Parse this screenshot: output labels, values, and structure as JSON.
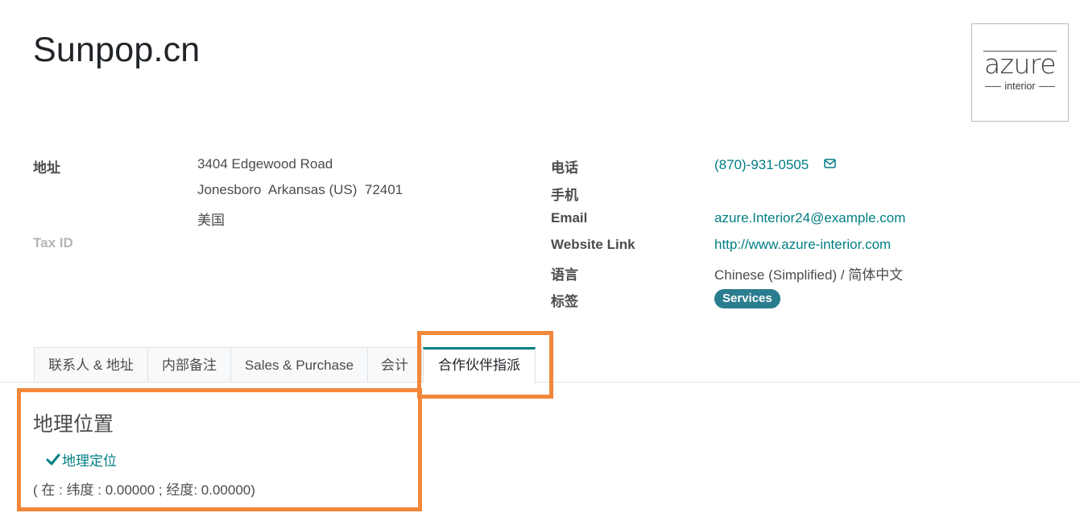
{
  "record": {
    "name": "Sunpop.cn"
  },
  "avatar": {
    "logo_text": "azure",
    "logo_subtext": "interior"
  },
  "address": {
    "label": "地址",
    "street": "3404 Edgewood Road",
    "city_line": "Jonesboro  Arkansas (US)  72401",
    "country": "美国"
  },
  "tax_id": {
    "label": "Tax ID"
  },
  "contact": {
    "phone_label": "电话",
    "phone": "(870)-931-0505",
    "mobile_label": "手机",
    "email_label": "Email",
    "email": "azure.Interior24@example.com",
    "website_label": "Website Link",
    "website": "http://www.azure-interior.com",
    "language_label": "语言",
    "language": "Chinese (Simplified) / 简体中文",
    "tags_label": "标签",
    "tag": "Services"
  },
  "tabs": [
    {
      "label": "联系人 & 地址"
    },
    {
      "label": "内部备注"
    },
    {
      "label": "Sales & Purchase"
    },
    {
      "label": "会计"
    },
    {
      "label": "合作伙伴指派",
      "active": true
    }
  ],
  "geo": {
    "title": "地理位置",
    "button_label": "地理定位",
    "coordinates": "( 在 : 纬度 : 0.00000 ; 经度: 0.00000)"
  },
  "colors": {
    "accent": "#017e84",
    "tag_bg": "#2a7d8f",
    "highlight": "#f2873a"
  }
}
